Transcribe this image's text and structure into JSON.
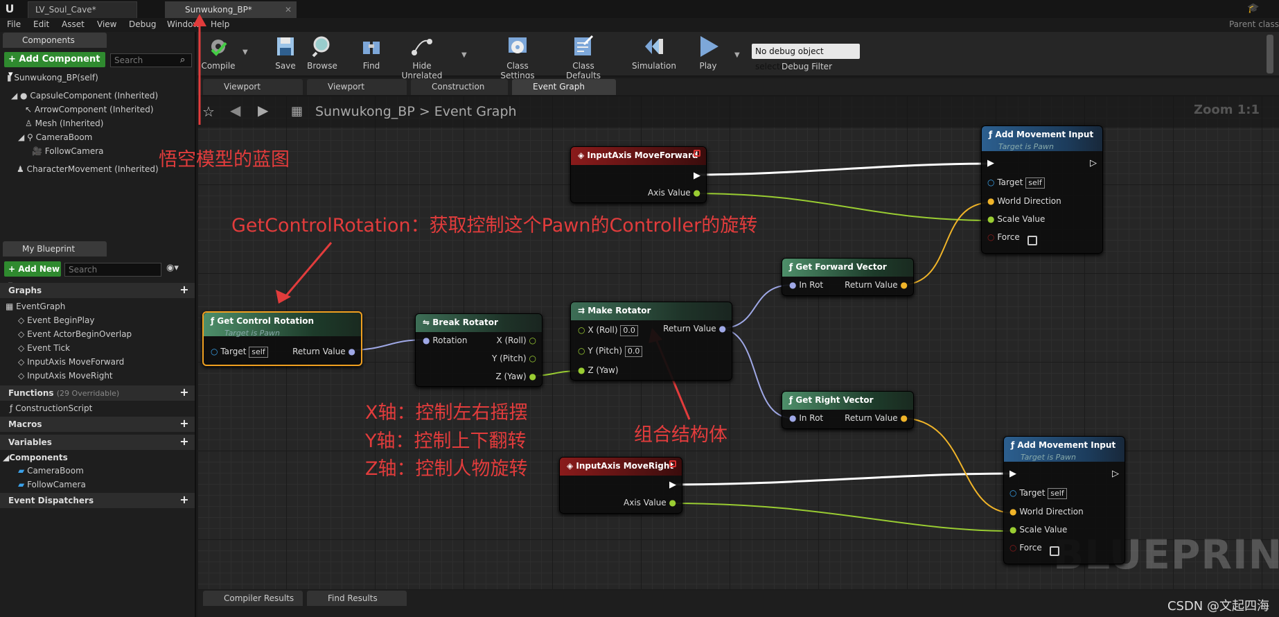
{
  "titlebar": {
    "tabs": [
      {
        "label": "LV_Soul_Cave*"
      },
      {
        "label": "Sunwukong_BP*"
      }
    ],
    "parent_class": "Parent class"
  },
  "menu": [
    "File",
    "Edit",
    "Asset",
    "View",
    "Debug",
    "Window",
    "Help"
  ],
  "components_panel": {
    "tab": "Components",
    "add_button": "+ Add Component ▾",
    "search_placeholder": "Search",
    "self_item": "Sunwukong_BP(self)",
    "tree": [
      "CapsuleComponent (Inherited)",
      "ArrowComponent (Inherited)",
      "Mesh (Inherited)",
      "CameraBoom",
      "FollowCamera",
      "CharacterMovement (Inherited)"
    ]
  },
  "blueprint_panel": {
    "tab": "My Blueprint",
    "add_button": "+ Add New ▾",
    "search_placeholder": "Search",
    "graphs_header": "Graphs",
    "event_graph": "EventGraph",
    "events": [
      "Event BeginPlay",
      "Event ActorBeginOverlap",
      "Event Tick",
      "InputAxis MoveForward",
      "InputAxis MoveRight"
    ],
    "functions_header": "Functions",
    "functions_count": "(29 Overridable)",
    "construction_script": "ConstructionScript",
    "macros_header": "Macros",
    "variables_header": "Variables",
    "components_header": "Components",
    "components": [
      "CameraBoom",
      "FollowCamera"
    ],
    "dispatchers_header": "Event Dispatchers"
  },
  "toolbar": {
    "compile": "Compile",
    "save": "Save",
    "browse": "Browse",
    "find": "Find",
    "hide_unrelated": "Hide Unrelated",
    "class_settings": "Class Settings",
    "class_defaults": "Class Defaults",
    "simulation": "Simulation",
    "play": "Play",
    "debug_select": "No debug object selected ▾",
    "debug_filter": "Debug Filter"
  },
  "graph_tabs": [
    "Viewport",
    "Viewport",
    "Construction Scrip",
    "Event Graph"
  ],
  "breadcrumb": {
    "bp": "Sunwukong_BP",
    "sep": ">",
    "graph": "Event Graph"
  },
  "zoom": "Zoom 1:1",
  "watermark": "BLUEPRINT",
  "nodes": {
    "get_control_rotation": {
      "title": "Get Control Rotation",
      "sub": "Target is Pawn",
      "target": "Target",
      "self": "self",
      "ret": "Return Value"
    },
    "break_rotator": {
      "title": "Break Rotator",
      "rotation": "Rotation",
      "x": "X (Roll)",
      "y": "Y (Pitch)",
      "z": "Z (Yaw)"
    },
    "make_rotator": {
      "title": "Make Rotator",
      "x": "X (Roll)",
      "y": "Y (Pitch)",
      "z": "Z (Yaw)",
      "xv": "0.0",
      "yv": "0.0",
      "ret": "Return Value"
    },
    "axis_forward": {
      "title": "InputAxis MoveForward",
      "axis": "Axis Value"
    },
    "axis_right": {
      "title": "InputAxis MoveRight",
      "axis": "Axis Value"
    },
    "get_forward": {
      "title": "Get Forward Vector",
      "in": "In Rot",
      "ret": "Return Value"
    },
    "get_right": {
      "title": "Get Right Vector",
      "in": "In Rot",
      "ret": "Return Value"
    },
    "add_move_1": {
      "title": "Add Movement Input",
      "sub": "Target is Pawn",
      "target": "Target",
      "self": "self",
      "dir": "World Direction",
      "scale": "Scale Value",
      "force": "Force"
    },
    "add_move_2": {
      "title": "Add Movement Input",
      "sub": "Target is Pawn",
      "target": "Target",
      "self": "self",
      "dir": "World Direction",
      "scale": "Scale Value",
      "force": "Force"
    }
  },
  "annotations": {
    "model_bp": "悟空模型的蓝图",
    "gcr": "GetControlRotation：获取控制这个Pawn的Controller的旋转",
    "x_axis": "X轴：控制左右摇摆",
    "y_axis": "Y轴：控制上下翻转",
    "z_axis": "Z轴：控制人物旋转",
    "struct": "组合结构体"
  },
  "bottom_tabs": [
    "Compiler Results",
    "Find Results"
  ],
  "credit": "CSDN @文起四海",
  "colors": {
    "annotation": "#e23c3c",
    "exec_wire": "#ffffff",
    "float_wire": "#9acd32",
    "vector_wire": "#f0b429",
    "rotator_wire": "#9fa8e6"
  }
}
